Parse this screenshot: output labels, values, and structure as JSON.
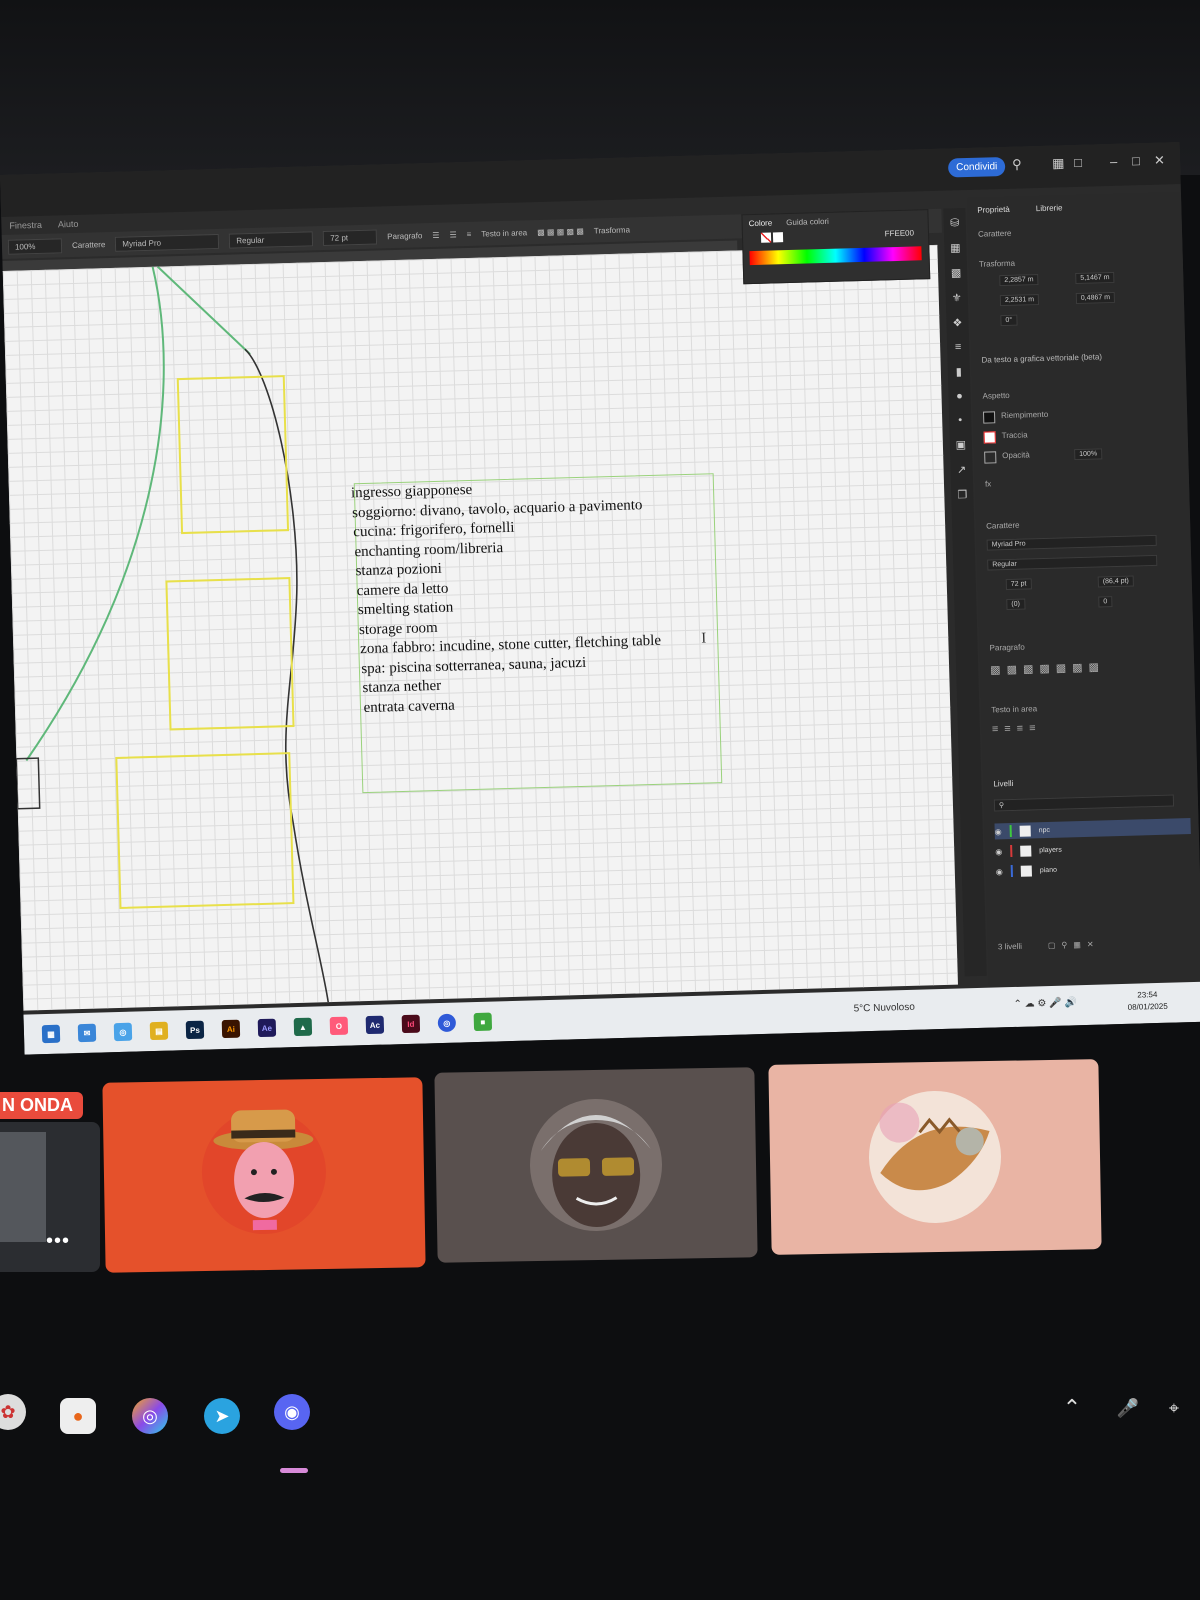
{
  "window": {
    "share_label": "Condividi",
    "menu": [
      "Finestra",
      "Aiuto"
    ]
  },
  "control_bar": {
    "zoom": "100%",
    "char_label": "Carattere",
    "font": "Myriad Pro",
    "style": "Regular",
    "size": "72 pt",
    "paragraph_label": "Paragrafo",
    "text_wrap_label": "Testo in area",
    "transform_label": "Trasforma"
  },
  "color_panel": {
    "tabs": [
      "Colore",
      "Guida colori"
    ],
    "hex": "FFEE00"
  },
  "canvas": {
    "note_lines": [
      "ingresso giapponese",
      "soggiorno: divano, tavolo, acquario a pavimento",
      "cucina: frigorifero, fornelli",
      "enchanting room/libreria",
      "stanza pozioni",
      "camere da letto",
      "smelting station",
      "storage room",
      "zona fabbro: incudine, stone cutter, fletching table",
      "spa: piscina sotterranea, sauna, jacuzi",
      "stanza nether",
      "entrata caverna"
    ],
    "colors": {
      "grid": "#dcdcdc",
      "yellow_box": "#e8e04a",
      "green_path": "#5fb87a",
      "note_border": "#9ad27c"
    }
  },
  "properties_panel": {
    "tabs": [
      "Proprietà",
      "Librerie"
    ],
    "section_char": "Carattere",
    "section_transform": "Trasforma",
    "x": "2,2857 m",
    "y": "2,2531 m",
    "w": "5,1467 m",
    "h": "0,4867 m",
    "angle": "0°",
    "vector_option": "Da testo a grafica vettoriale (beta)",
    "section_appearance": "Aspetto",
    "fill_label": "Riempimento",
    "stroke_label": "Traccia",
    "opacity_label": "Opacità",
    "opacity": "100%",
    "fx": "fx",
    "font": "Myriad Pro",
    "style": "Regular",
    "size": "72 pt",
    "leading": "(86,4 pt)",
    "tracking": "0",
    "kerning": "(0)",
    "section_paragraph": "Paragrafo",
    "section_area": "Testo in area",
    "section_layers": "Livelli",
    "layers": [
      {
        "name": "npc",
        "color": "#3ec93e"
      },
      {
        "name": "players",
        "color": "#d73a3a"
      },
      {
        "name": "piano",
        "color": "#3a6ad7"
      }
    ],
    "layers_count": "3 livelli"
  },
  "taskbar": {
    "weather": "5°C  Nuvoloso",
    "time": "23:54",
    "date": "08/01/2025",
    "apps": [
      "Ps",
      "Ai",
      "Ae",
      "Ac",
      "Id"
    ]
  },
  "call": {
    "onair_label": "N ONDA",
    "more_label": "•••"
  }
}
